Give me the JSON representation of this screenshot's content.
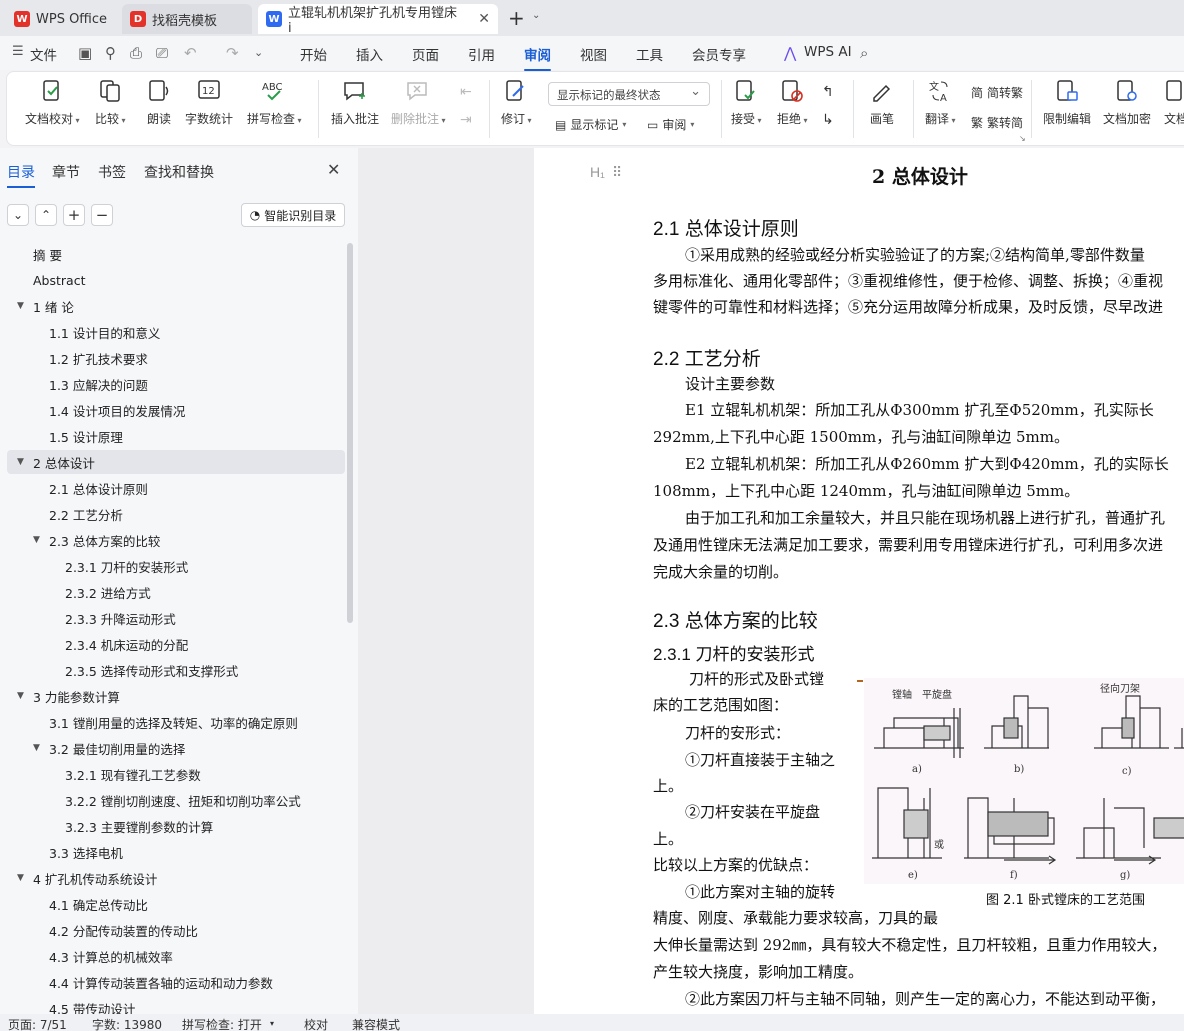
{
  "tabs": [
    {
      "label": "WPS Office"
    },
    {
      "label": "找稻壳模板"
    },
    {
      "label": "立辊轧机机架扩孔机专用镗床i"
    }
  ],
  "menu": {
    "file": "文件",
    "items": [
      "开始",
      "插入",
      "页面",
      "引用",
      "审阅",
      "视图",
      "工具",
      "会员专享"
    ],
    "ai": "WPS AI",
    "active": "审阅"
  },
  "ribbon": {
    "proof": "文档校对",
    "compare": "比较",
    "read": "朗读",
    "wordcount": "字数统计",
    "spell": "拼写检查",
    "insert_comment": "插入批注",
    "delete_comment": "删除批注",
    "track": "修订",
    "display_combo": "显示标记的最终状态",
    "show_markup": "显示标记",
    "review": "审阅",
    "accept": "接受",
    "reject": "拒绝",
    "pen": "画笔",
    "translate": "翻译",
    "simp_trad": "简转繁",
    "trad_simp": "繁转简",
    "restrict": "限制编辑",
    "encrypt": "文档加密",
    "doc": "文档"
  },
  "nav": {
    "tabs": [
      "目录",
      "章节",
      "书签",
      "查找和替换"
    ],
    "smart": "智能识别目录",
    "toc": [
      {
        "label": "摘  要",
        "level": 0
      },
      {
        "label": "Abstract",
        "level": 0
      },
      {
        "label": "1   绪  论",
        "level": 0,
        "arrow": true
      },
      {
        "label": "1.1  设计目的和意义",
        "level": 1
      },
      {
        "label": "1.2  扩孔技术要求",
        "level": 1
      },
      {
        "label": "1.3  应解决的问题",
        "level": 1
      },
      {
        "label": "1.4  设计项目的发展情况",
        "level": 1
      },
      {
        "label": "1.5 设计原理",
        "level": 1
      },
      {
        "label": "2    总体设计",
        "level": 0,
        "arrow": true,
        "selected": true
      },
      {
        "label": "2.1  总体设计原则",
        "level": 1
      },
      {
        "label": "2.2  工艺分析",
        "level": 1
      },
      {
        "label": "2.3  总体方案的比较",
        "level": 1,
        "arrow": true
      },
      {
        "label": "2.3.1  刀杆的安装形式",
        "level": 2
      },
      {
        "label": "2.3.2  进给方式",
        "level": 2
      },
      {
        "label": "2.3.3  升降运动形式",
        "level": 2
      },
      {
        "label": "2.3.4  机床运动的分配",
        "level": 2
      },
      {
        "label": "2.3.5  选择传动形式和支撑形式",
        "level": 2
      },
      {
        "label": "3    力能参数计算",
        "level": 0,
        "arrow": true
      },
      {
        "label": "3.1  镗削用量的选择及转矩、功率的确定原则",
        "level": 1
      },
      {
        "label": "3.2  最佳切削用量的选择",
        "level": 1,
        "arrow": true
      },
      {
        "label": "3.2.1  现有镗孔工艺参数",
        "level": 2
      },
      {
        "label": "3.2.2  镗削切削速度、扭矩和切削功率公式",
        "level": 2
      },
      {
        "label": "3.2.3 主要镗削参数的计算",
        "level": 2
      },
      {
        "label": "3.3  选择电机",
        "level": 1
      },
      {
        "label": "4    扩孔机传动系统设计",
        "level": 0,
        "arrow": true
      },
      {
        "label": "4.1  确定总传动比",
        "level": 1
      },
      {
        "label": "4.2  分配传动装置的传动比",
        "level": 1
      },
      {
        "label": "4.3  计算总的机械效率",
        "level": 1
      },
      {
        "label": "4.4 计算传动装置各轴的运动和动力参数",
        "level": 1
      },
      {
        "label": "4.5  带传动设计",
        "level": 1
      }
    ]
  },
  "doc": {
    "hmark": "H₁",
    "chapter": "2    总体设计",
    "s21": "2.1  总体设计原则",
    "s21_l1": "①采用成熟的经验或经分析实验验证了的方案;②结构简单,零部件数量",
    "s21_l2": "多用标准化、通用化零部件；③重视维修性，便于检修、调整、拆换；④重视",
    "s21_l3": "键零件的可靠性和材料选择；⑤充分运用故障分析成果，及时反馈，尽早改进",
    "s22": "2.2  工艺分析",
    "s22_l1": "设计主要参数",
    "s22_l2": "E1 立辊轧机机架：所加工孔从Φ300mm 扩孔至Φ520mm，孔实际长",
    "s22_l3": "292mm,上下孔中心距 1500mm，孔与油缸间隙单边 5mm。",
    "s22_l4": "E2 立辊轧机机架：所加工孔从Φ260mm 扩大到Φ420mm，孔的实际长",
    "s22_l5": "108mm，上下孔中心距 1240mm，孔与油缸间隙单边 5mm。",
    "s22_l6": "由于加工孔和加工余量较大，并且只能在现场机器上进行扩孔，普通扩孔",
    "s22_l7": "及通用性镗床无法满足加工要求，需要利用专用镗床进行扩孔，可利用多次进",
    "s22_l8": "完成大余量的切削。",
    "s23": "2.3  总体方案的比较",
    "s231": "2.3.1  刀杆的安装形式",
    "s231_l1": "刀杆的形式及卧式镗",
    "s231_l2": "床的工艺范围如图：",
    "s231_l3": "刀杆的安形式：",
    "s231_l4": "①刀杆直接装于主轴之",
    "s231_l5": "上。",
    "s231_l6": "②刀杆安装在平旋盘",
    "s231_l7": "上。",
    "s231_l8": "比较以上方案的优缺点：",
    "s231_l9": "①此方案对主轴的旋转",
    "s231_l10": "精度、刚度、承载能力要求较高，刀具的最",
    "s231_l11": "大伸长量需达到 292㎜，具有较大不稳定性，且刀杆较粗，且重力作用较大，",
    "s231_l12": "产生较大挠度，影响加工精度。",
    "s231_l13": "②此方案因刀杆与主轴不同轴，则产生一定的离心力，不能达到动平衡，",
    "fig_caption": "图 2.1  卧式镗床的工艺范围",
    "fig_labels": {
      "a": "a)",
      "b": "b)",
      "c": "c)",
      "e": "e)",
      "f": "f)",
      "g": "g)",
      "spindle": "镗轴",
      "plate": "平旋盘",
      "radial": "径向刀架",
      "or": "或"
    }
  },
  "status": {
    "page": "页面: 7/51",
    "words": "字数: 13980",
    "spell": "拼写检查: 打开",
    "proof": "校对",
    "compat": "兼容模式"
  }
}
